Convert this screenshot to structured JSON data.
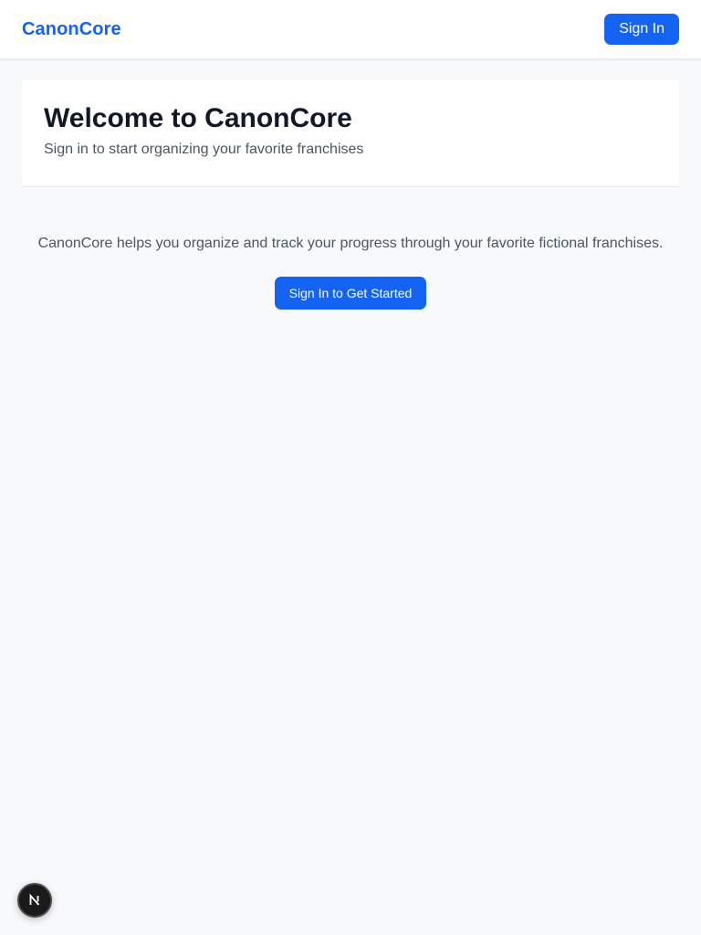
{
  "header": {
    "brand": "CanonCore",
    "sign_in_label": "Sign In"
  },
  "hero": {
    "title": "Welcome to CanonCore",
    "subtitle": "Sign in to start organizing your favorite franchises"
  },
  "intro": {
    "description": "CanonCore helps you organize and track your progress through your favorite fictional franchises.",
    "cta_label": "Sign In to Get Started"
  },
  "dev_indicator": {
    "icon": "nextjs-logo-icon"
  },
  "colors": {
    "accent": "#1463f3",
    "background": "#f8f9fb",
    "text_primary": "#111827",
    "text_secondary": "#4b5563"
  }
}
